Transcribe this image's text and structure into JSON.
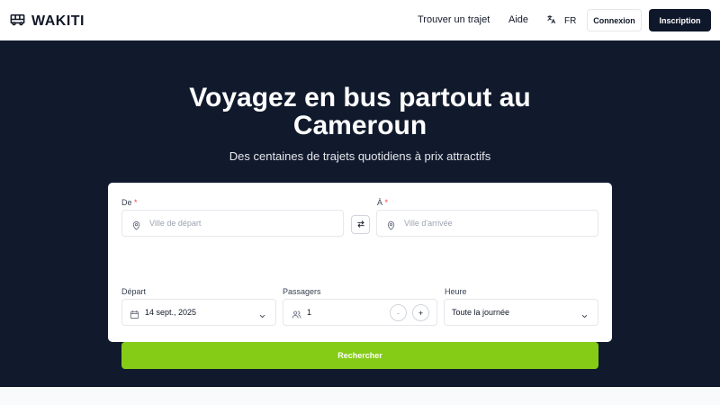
{
  "brand": {
    "name": "WAKITI"
  },
  "nav": {
    "find_trip": "Trouver un trajet",
    "help": "Aide",
    "language": "FR",
    "login": "Connexion",
    "signup": "Inscription"
  },
  "hero": {
    "title": "Voyagez en bus partout au Cameroun",
    "subtitle": "Des centaines de trajets quotidiens à prix attractifs"
  },
  "search": {
    "from_label": "De",
    "to_label": "À",
    "required_mark": "*",
    "from_placeholder": "Ville de départ",
    "to_placeholder": "Ville d'arrivée",
    "date_label": "Départ",
    "date_value": "14 sept., 2025",
    "passengers_label": "Passagers",
    "passengers_value": "1",
    "minus": "-",
    "plus": "+",
    "time_label": "Heure",
    "time_value": "Toute la journée",
    "submit": "Rechercher"
  },
  "icons": {
    "logo": "bus-icon",
    "language": "translate-icon",
    "from": "map-pin-icon",
    "to": "map-pin-icon",
    "swap": "swap-arrows-icon",
    "date": "calendar-icon",
    "passengers": "users-icon",
    "dropdown": "chevron-down-icon"
  },
  "colors": {
    "hero_bg": "#111a2d",
    "primary_dark": "#0f172a",
    "accent_green": "#84cc16",
    "required": "#ef4444"
  }
}
